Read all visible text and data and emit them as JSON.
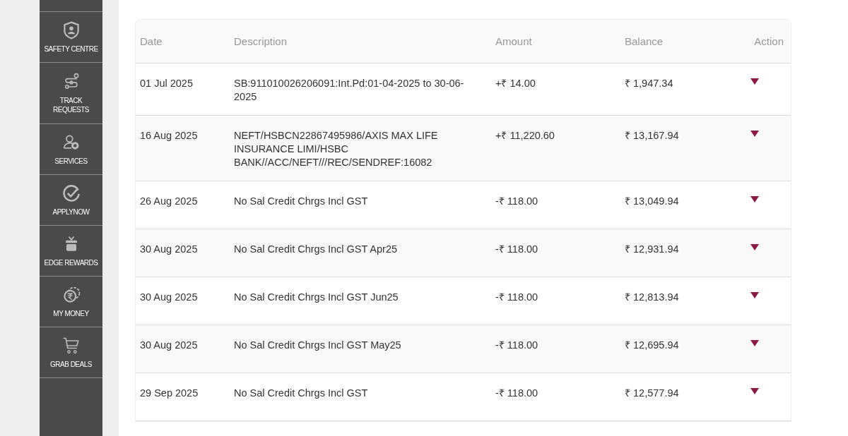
{
  "sidebar": {
    "items": [
      {
        "label": "SAFETY CENTRE"
      },
      {
        "label": "TRACK\nREQUESTS"
      },
      {
        "label": "SERVICES"
      },
      {
        "label": "APPLYNOW"
      },
      {
        "label": "EDGE REWARDS"
      },
      {
        "label": "MY MONEY"
      },
      {
        "label": "GRAB DEALS"
      }
    ]
  },
  "table": {
    "columns": [
      "Date",
      "Description",
      "Amount",
      "Balance",
      "Action"
    ],
    "rows": [
      {
        "date": "01 Jul 2025",
        "description": "SB:911010026206091:Int.Pd:01-04-2025 to 30-06-2025",
        "amount": "+₹ 14.00",
        "balance": "₹ 1,947.34"
      },
      {
        "date": "16 Aug 2025",
        "description": "NEFT/HSBCN22867495986/AXIS MAX LIFE INSURANCE LIMI/HSBC BANK//ACC/NEFT///REC/SENDREF:16082",
        "amount": "+₹ 11,220.60",
        "balance": "₹ 13,167.94"
      },
      {
        "date": "26 Aug 2025",
        "description": "No Sal Credit Chrgs Incl GST",
        "amount": "-₹ 118.00",
        "balance": "₹ 13,049.94"
      },
      {
        "date": "30 Aug 2025",
        "description": "No Sal Credit Chrgs Incl GST Apr25",
        "amount": "-₹ 118.00",
        "balance": "₹ 12,931.94"
      },
      {
        "date": "30 Aug 2025",
        "description": "No Sal Credit Chrgs Incl GST Jun25",
        "amount": "-₹ 118.00",
        "balance": "₹ 12,813.94"
      },
      {
        "date": "30 Aug 2025",
        "description": "No Sal Credit Chrgs Incl GST May25",
        "amount": "-₹ 118.00",
        "balance": "₹ 12,695.94"
      },
      {
        "date": "29 Sep 2025",
        "description": "No Sal Credit Chrgs Incl GST",
        "amount": "-₹ 118.00",
        "balance": "₹ 12,577.94"
      }
    ]
  }
}
